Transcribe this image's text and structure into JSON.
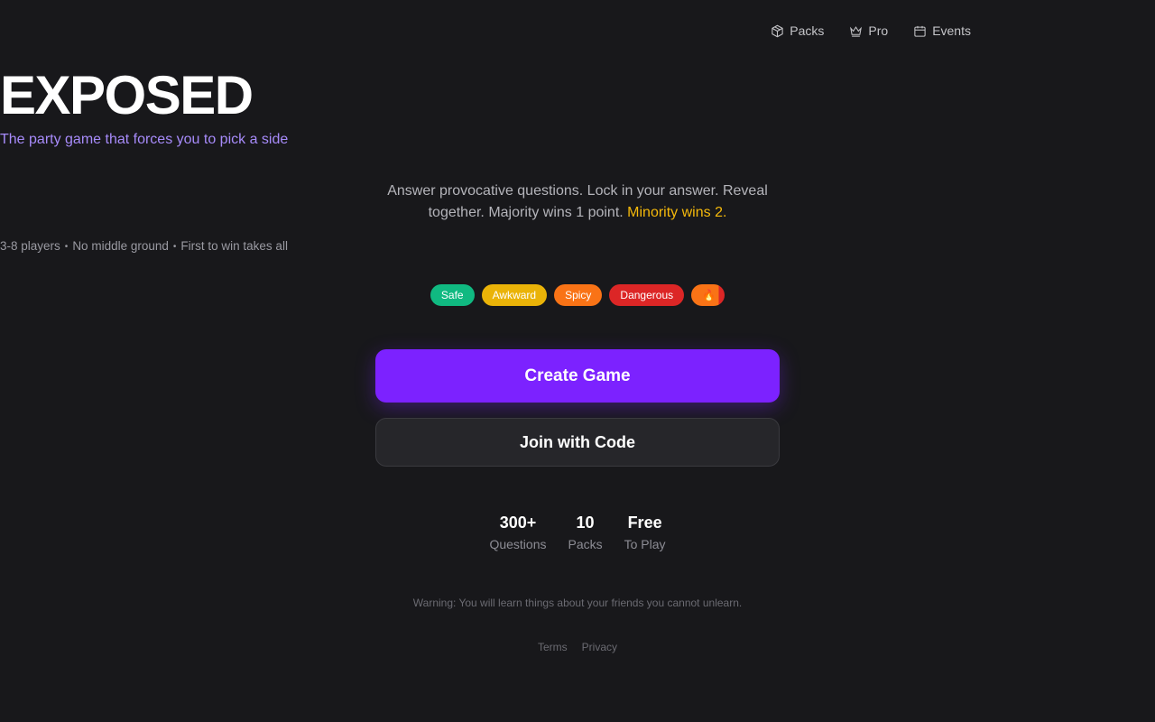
{
  "nav": {
    "items": [
      {
        "label": "Packs",
        "icon": "box-icon"
      },
      {
        "label": "Pro",
        "icon": "crown-icon"
      },
      {
        "label": "Events",
        "icon": "calendar-icon"
      }
    ]
  },
  "hero": {
    "title": "EXPOSED",
    "tagline": "The party game that forces you to pick a side",
    "description_main": "Answer provocative questions. Lock in your answer. Reveal together. Majority wins 1 point.",
    "description_highlight": "Minority wins 2.",
    "meta": [
      "3-8 players",
      "No middle ground",
      "First to win takes all"
    ],
    "meta_separator": "•"
  },
  "levels": [
    {
      "label": "Safe",
      "color": "#10b981"
    },
    {
      "label": "Awkward",
      "color": "#eab308"
    },
    {
      "label": "Spicy",
      "color": "#f97316"
    },
    {
      "label": "Dangerous",
      "color": "#dc2626"
    },
    {
      "label": "🔥",
      "color": "#f97316"
    }
  ],
  "actions": {
    "create": "Create Game",
    "join": "Join with Code"
  },
  "stats": [
    {
      "value": "300+",
      "label": "Questions"
    },
    {
      "value": "10",
      "label": "Packs"
    },
    {
      "value": "Free",
      "label": "To Play"
    }
  ],
  "warning": "Warning: You will learn things about your friends you cannot unlearn.",
  "footer": {
    "terms": "Terms",
    "privacy": "Privacy"
  },
  "colors": {
    "background": "#18181b",
    "accent": "#7c22ff",
    "tagline": "#a78bfa",
    "highlight": "#f5b90b"
  }
}
